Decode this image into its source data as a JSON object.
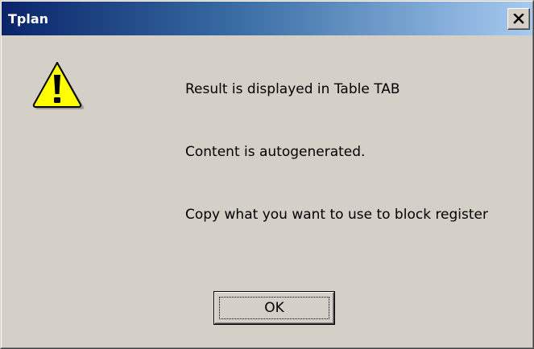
{
  "window": {
    "title": "Tplan",
    "close_icon": "close-icon",
    "colors": {
      "titlebar_start": "#0a246a",
      "titlebar_end": "#a6caf0",
      "face": "#d4d0c8"
    }
  },
  "dialog": {
    "icon": "warning-icon",
    "messages": [
      "Result is displayed in Table TAB",
      "Content is autogenerated.",
      "Copy what you want to use to block register"
    ],
    "ok_label": "OK"
  }
}
